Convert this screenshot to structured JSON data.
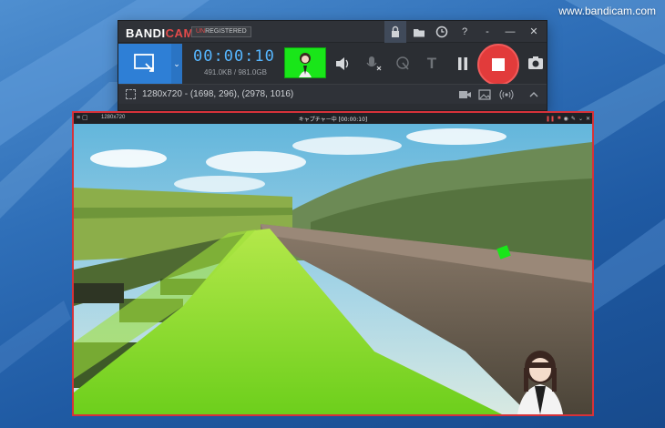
{
  "watermark": "www.bandicam.com",
  "app": {
    "logo_main": "BANDI",
    "logo_accent": "CAM",
    "registration_prefix": "UN",
    "registration_rest": "REGISTERED",
    "titlebar_icons": [
      "lock-icon",
      "folder-icon",
      "clock-icon",
      "help-icon",
      "minimize-icon",
      "close-icon"
    ],
    "help_glyph": "?",
    "min_glyph": "-",
    "collapse_glyph": "—",
    "close_glyph": "✕"
  },
  "toolbar": {
    "timer": "00:00:10",
    "filesize": "491.0KB / 981.0GB",
    "mode_dropdown_glyph": "⌄",
    "text_glyph": "T"
  },
  "infobar": {
    "region": "1280x720 - (1698, 296), (2978, 1016)"
  },
  "capture": {
    "resolution": "1280x720",
    "title": "キャプチャー中 [00:00:10]"
  },
  "colors": {
    "accent_blue": "#2e7fd6",
    "record_red": "#e23b3b",
    "timer_blue": "#56b6ff",
    "capture_border": "#d6323a",
    "thumb_green": "#19e619"
  }
}
